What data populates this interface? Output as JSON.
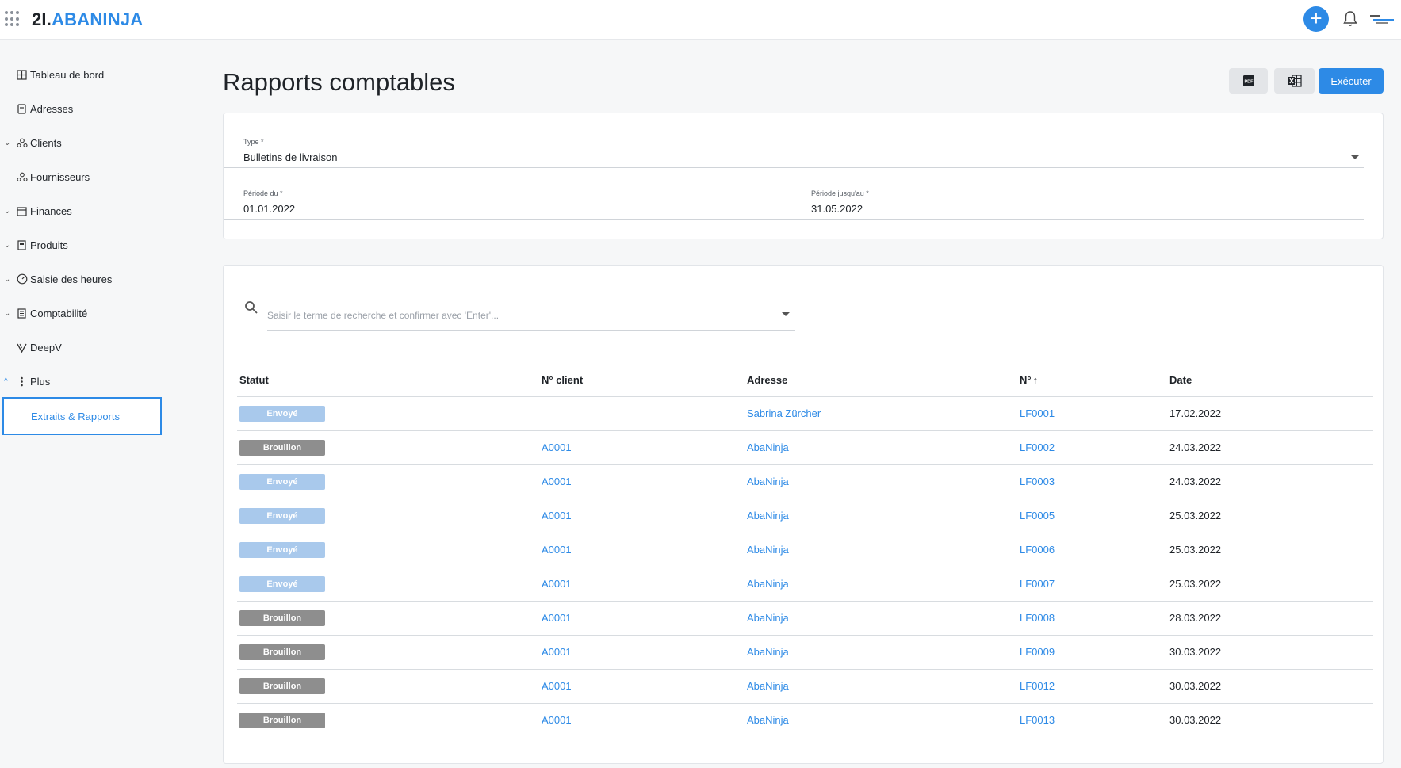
{
  "app": {
    "logo_prefix": "2I.",
    "logo_name": "ABANINJA"
  },
  "sidebar": {
    "items": [
      {
        "label": "Tableau de bord",
        "icon": "dashboard-icon",
        "chevron": ""
      },
      {
        "label": "Adresses",
        "icon": "address-book-icon",
        "chevron": ""
      },
      {
        "label": "Clients",
        "icon": "clients-icon",
        "chevron": "⌄"
      },
      {
        "label": "Fournisseurs",
        "icon": "suppliers-icon",
        "chevron": ""
      },
      {
        "label": "Finances",
        "icon": "finances-icon",
        "chevron": "⌄"
      },
      {
        "label": "Produits",
        "icon": "products-icon",
        "chevron": "⌄"
      },
      {
        "label": "Saisie des heures",
        "icon": "clock-icon",
        "chevron": "⌄"
      },
      {
        "label": "Comptabilité",
        "icon": "ledger-icon",
        "chevron": "⌄"
      },
      {
        "label": "DeepV",
        "icon": "deepv-icon",
        "chevron": ""
      },
      {
        "label": "Plus",
        "icon": "more-vertical-icon",
        "chevron": "^"
      }
    ],
    "active_sub": "Extraits & Rapports"
  },
  "page": {
    "title": "Rapports comptables",
    "run_label": "Exécuter",
    "pdf_icon_text": "PDF"
  },
  "filters": {
    "type_label": "Type *",
    "type_value": "Bulletins de livraison",
    "from_label": "Période du *",
    "from_value": "01.01.2022",
    "to_label": "Période jusqu'au *",
    "to_value": "31.05.2022"
  },
  "search": {
    "placeholder": "Saisir le terme de recherche et confirmer avec 'Enter'..."
  },
  "table": {
    "columns": [
      "Statut",
      "N° client",
      "Adresse",
      "N°",
      "Date"
    ],
    "sort_indicator": "↑",
    "rows": [
      {
        "status": "Envoyé",
        "status_type": "sent",
        "client": "",
        "address": "Sabrina Zürcher",
        "number": "LF0001",
        "date": "17.02.2022"
      },
      {
        "status": "Brouillon",
        "status_type": "draft",
        "client": "A0001",
        "address": "AbaNinja",
        "number": "LF0002",
        "date": "24.03.2022"
      },
      {
        "status": "Envoyé",
        "status_type": "sent",
        "client": "A0001",
        "address": "AbaNinja",
        "number": "LF0003",
        "date": "24.03.2022"
      },
      {
        "status": "Envoyé",
        "status_type": "sent",
        "client": "A0001",
        "address": "AbaNinja",
        "number": "LF0005",
        "date": "25.03.2022"
      },
      {
        "status": "Envoyé",
        "status_type": "sent",
        "client": "A0001",
        "address": "AbaNinja",
        "number": "LF0006",
        "date": "25.03.2022"
      },
      {
        "status": "Envoyé",
        "status_type": "sent",
        "client": "A0001",
        "address": "AbaNinja",
        "number": "LF0007",
        "date": "25.03.2022"
      },
      {
        "status": "Brouillon",
        "status_type": "draft",
        "client": "A0001",
        "address": "AbaNinja",
        "number": "LF0008",
        "date": "28.03.2022"
      },
      {
        "status": "Brouillon",
        "status_type": "draft",
        "client": "A0001",
        "address": "AbaNinja",
        "number": "LF0009",
        "date": "30.03.2022"
      },
      {
        "status": "Brouillon",
        "status_type": "draft",
        "client": "A0001",
        "address": "AbaNinja",
        "number": "LF0012",
        "date": "30.03.2022"
      },
      {
        "status": "Brouillon",
        "status_type": "draft",
        "client": "A0001",
        "address": "AbaNinja",
        "number": "LF0013",
        "date": "30.03.2022"
      }
    ]
  },
  "colors": {
    "accent": "#2d8ae6",
    "sent_badge": "#a9c9ec",
    "draft_badge": "#8e8e8e"
  }
}
